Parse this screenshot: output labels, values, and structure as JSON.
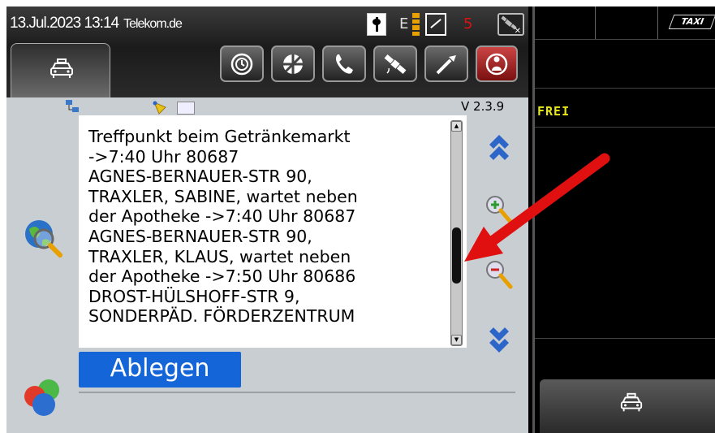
{
  "status_bar": {
    "datetime": "13.Jul.2023 13:14",
    "operator": "Telekom.de",
    "network_letter": "E",
    "counter": "5"
  },
  "toolbar": {
    "tabs": [
      "taxi-icon"
    ],
    "buttons": [
      "clock-icon",
      "dispatch-icon",
      "phone-icon",
      "satellite-icon",
      "tools-icon",
      "alarm-icon"
    ]
  },
  "main": {
    "version": "V 2.3.9",
    "message_text": "Treffpunkt beim Getränkemarkt\n->7:40 Uhr 80687\nAGNES-BERNAUER-STR 90,\nTRAXLER, SABINE, wartet neben\nder Apotheke ->7:40 Uhr 80687\nAGNES-BERNAUER-STR 90,\nTRAXLER, KLAUS, wartet neben\nder Apotheke ->7:50 Uhr 80686\nDROST-HÜLSHOFF-STR 9,\nSONDERPÄD. FÖRDERZENTRUM",
    "ablegen_label": "Ablegen",
    "scroll_position": 0.65
  },
  "meter": {
    "badge": "TAXI",
    "status": "FREI"
  },
  "colors": {
    "accent": "#1466d8",
    "panel": "#c9ced3",
    "status_text": "#e8e817",
    "counter": "#e01010",
    "annotation_arrow": "#e01010"
  }
}
